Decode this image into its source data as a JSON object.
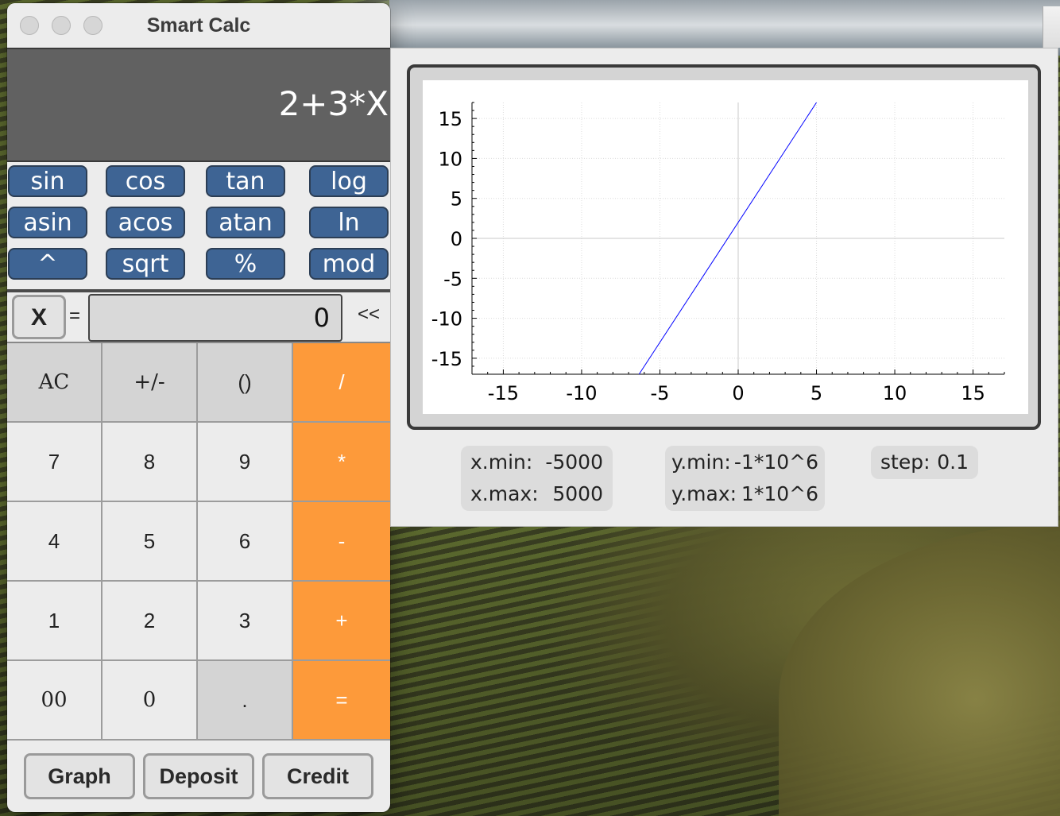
{
  "window": {
    "title": "Smart Calc"
  },
  "display": {
    "expression": "2+3*X"
  },
  "functions": [
    [
      "sin",
      "cos",
      "tan",
      "log"
    ],
    [
      "asin",
      "acos",
      "atan",
      "ln"
    ],
    [
      "^",
      "sqrt",
      "%",
      "mod"
    ]
  ],
  "x_row": {
    "x_label": "X",
    "equals": "=",
    "value": "0",
    "backspace": "<<"
  },
  "keypad": [
    [
      "AC",
      "+/-",
      "()",
      "/"
    ],
    [
      "7",
      "8",
      "9",
      "*"
    ],
    [
      "4",
      "5",
      "6",
      "-"
    ],
    [
      "1",
      "2",
      "3",
      "+"
    ],
    [
      "00",
      "0",
      ".",
      "="
    ]
  ],
  "bottom_buttons": {
    "graph": "Graph",
    "deposit": "Deposit",
    "credit": "Credit"
  },
  "graph": {
    "x_min_label": "x.min:",
    "x_min": "-5000",
    "x_max_label": "x.max:",
    "x_max": "5000",
    "y_min_label": "y.min:",
    "y_min": "-1*10^6",
    "y_max_label": "y.max:",
    "y_max": "1*10^6",
    "step_label": "step:",
    "step": "0.1",
    "line_color": "#0000ff"
  },
  "chart_data": {
    "type": "line",
    "x": [
      -6.33,
      5.0
    ],
    "y": [
      -17,
      17
    ],
    "xlim": [
      -17,
      17
    ],
    "ylim": [
      -17,
      17
    ],
    "xticks": [
      "-15",
      "-10",
      "-5",
      "0",
      "5",
      "10",
      "15"
    ],
    "yticks": [
      "15",
      "10",
      "5",
      "0",
      "-5",
      "-10",
      "-15"
    ],
    "grid": true
  },
  "colors": {
    "function_button": "#3e6494",
    "operator_key": "#fd9a3a",
    "display_bg": "#616161"
  }
}
